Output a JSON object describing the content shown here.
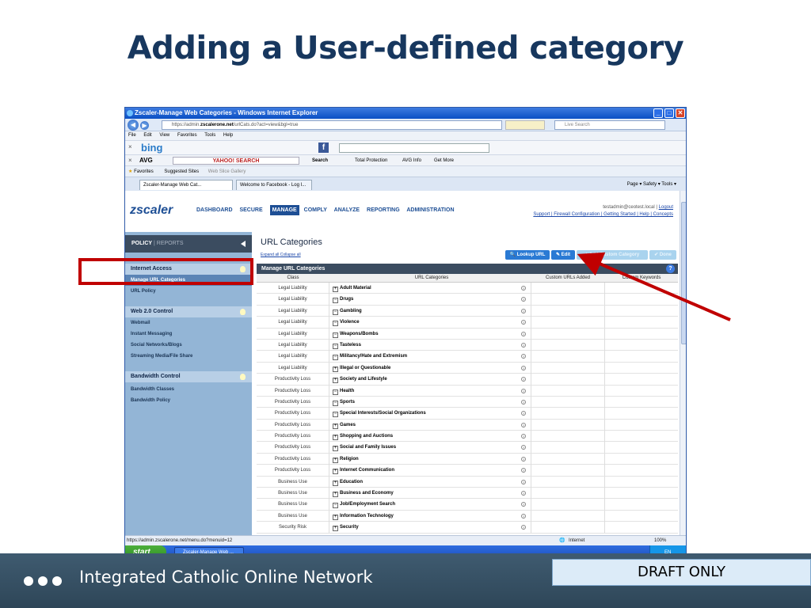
{
  "slide": {
    "title": "Adding a User-defined category",
    "footer_text": "Integrated Catholic Online Network",
    "draft_label": "DRAFT ONLY"
  },
  "browser": {
    "window_title": "Zscaler-Manage Web Categories - Windows Internet Explorer",
    "url_prefix": "https://admin.",
    "url_domain": "zscalerone.net",
    "url_rest": "/urlCats.do?act=view&bgl=true",
    "search_placeholder": "Live Search",
    "menu": [
      "File",
      "Edit",
      "View",
      "Favorites",
      "Tools",
      "Help"
    ],
    "bing_label": "bing",
    "avg_label": "AVG",
    "yahoo_label": "YAHOO! SEARCH",
    "avg_search": "Search",
    "avg_total": "Total Protection",
    "avg_info": "AVG Info",
    "avg_more": "Get More",
    "favorites": "Favorites",
    "suggested": "Suggested Sites",
    "webslice": "Web Slice Gallery",
    "tabs": [
      "Zscaler-Manage Web Cat...",
      "Welcome to Facebook - Log I..."
    ],
    "tab_tools": "Page ▾  Safety ▾  Tools ▾",
    "status_url": "https://admin.zscalerone.net/menu.do?menuid=12",
    "status_zone": "Internet",
    "status_zoom": "100%",
    "taskbar_start": "start",
    "taskbar_item": "Zscaler-Manage Web ...",
    "tray_lang": "EN"
  },
  "zscaler": {
    "logo": "zscaler",
    "nav": [
      "DASHBOARD",
      "SECURE",
      "MANAGE",
      "COMPLY",
      "ANALYZE",
      "REPORTING",
      "ADMINISTRATION"
    ],
    "user": "testadmin@ceotest.local",
    "logout": "Logout",
    "links": "Support | Firewall Configuration | Getting Started | Help | Concepts"
  },
  "sidebar": {
    "policy": "POLICY",
    "reports": "REPORTS",
    "sections": [
      {
        "title": "Internet Access",
        "items": [
          "Manage URL Categories",
          "URL Policy"
        ]
      },
      {
        "title": "Web 2.0 Control",
        "items": [
          "Webmail",
          "Instant Messaging",
          "Social Networks/Blogs",
          "Streaming Media/File Share"
        ]
      },
      {
        "title": "Bandwidth Control",
        "items": [
          "Bandwidth Classes",
          "Bandwidth Policy"
        ]
      }
    ]
  },
  "content": {
    "title": "URL Categories",
    "expand": "Expand all",
    "collapse": "Collapse all",
    "buttons": {
      "lookup": "Lookup URL",
      "edit": "Edit",
      "add": "Add Custom Category",
      "done": "Done"
    },
    "table_title": "Manage URL Categories",
    "columns": [
      "Class",
      "URL Categories",
      "Custom URLs Added",
      "Custom Keywords"
    ],
    "rows": [
      {
        "cls": "Legal Liability",
        "cat": "Adult Material",
        "sign": "+"
      },
      {
        "cls": "Legal Liability",
        "cat": "Drugs",
        "sign": "−"
      },
      {
        "cls": "Legal Liability",
        "cat": "Gambling",
        "sign": "−"
      },
      {
        "cls": "Legal Liability",
        "cat": "Violence",
        "sign": "−"
      },
      {
        "cls": "Legal Liability",
        "cat": "Weapons/Bombs",
        "sign": "−"
      },
      {
        "cls": "Legal Liability",
        "cat": "Tasteless",
        "sign": "−"
      },
      {
        "cls": "Legal Liability",
        "cat": "Militancy/Hate and Extremism",
        "sign": "−"
      },
      {
        "cls": "Legal Liability",
        "cat": "Illegal or Questionable",
        "sign": "+"
      },
      {
        "cls": "Productivity Loss",
        "cat": "Society and Lifestyle",
        "sign": "+"
      },
      {
        "cls": "Productivity Loss",
        "cat": "Health",
        "sign": "−"
      },
      {
        "cls": "Productivity Loss",
        "cat": "Sports",
        "sign": "−"
      },
      {
        "cls": "Productivity Loss",
        "cat": "Special Interests/Social Organizations",
        "sign": "−"
      },
      {
        "cls": "Productivity Loss",
        "cat": "Games",
        "sign": "+"
      },
      {
        "cls": "Productivity Loss",
        "cat": "Shopping and Auctions",
        "sign": "+"
      },
      {
        "cls": "Productivity Loss",
        "cat": "Social and Family Issues",
        "sign": "+"
      },
      {
        "cls": "Productivity Loss",
        "cat": "Religion",
        "sign": "+"
      },
      {
        "cls": "Productivity Loss",
        "cat": "Internet Communication",
        "sign": "+"
      },
      {
        "cls": "Business Use",
        "cat": "Education",
        "sign": "+"
      },
      {
        "cls": "Business Use",
        "cat": "Business and Economy",
        "sign": "+"
      },
      {
        "cls": "Business Use",
        "cat": "Job/Employment Search",
        "sign": "−"
      },
      {
        "cls": "Business Use",
        "cat": "Information Technology",
        "sign": "+"
      },
      {
        "cls": "Security Risk",
        "cat": "Security",
        "sign": "+"
      }
    ]
  },
  "colors": {
    "title": "#17375e",
    "annotation": "#c00000",
    "zscaler_blue": "#1e4f95"
  }
}
